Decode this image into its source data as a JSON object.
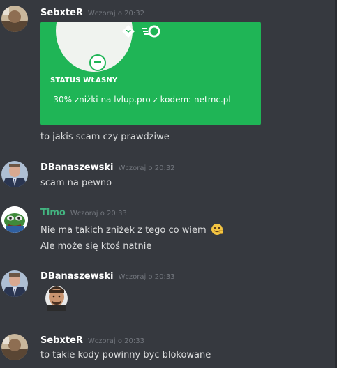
{
  "messages": [
    {
      "author": "SebxteR",
      "timestamp": "Wczoraj o 20:32",
      "card": {
        "status_title": "STATUS WŁASNY",
        "status_text": "-30% zniżki na lvlup.pro z kodem: netmc.pl"
      },
      "lines": [
        "to jakis scam czy prawdziwe"
      ]
    },
    {
      "author": "DBanaszewski",
      "timestamp": "Wczoraj o 20:32",
      "lines": [
        "scam na pewno"
      ]
    },
    {
      "author": "Timo",
      "timestamp": "Wczoraj o 20:33",
      "author_color": "#43b581",
      "lines": [
        "Nie ma takich zniżek z tego co wiem",
        "Ale może się ktoś natnie"
      ]
    },
    {
      "author": "DBanaszewski",
      "timestamp": "Wczoraj o 20:33",
      "lines": []
    },
    {
      "author": "SebxteR",
      "timestamp": "Wczoraj o 20:33",
      "lines": [
        "to takie kody powinny byc blokowane"
      ]
    }
  ],
  "colors": {
    "background": "#36393f",
    "card": "#1fb556",
    "timestamp": "#72767d",
    "text": "#dcddde"
  },
  "icons": [
    "dnd-status-icon",
    "hypesquad-badge-icon",
    "nitro-badge-icon",
    "emoji-icon",
    "custom-emoji-icon"
  ]
}
